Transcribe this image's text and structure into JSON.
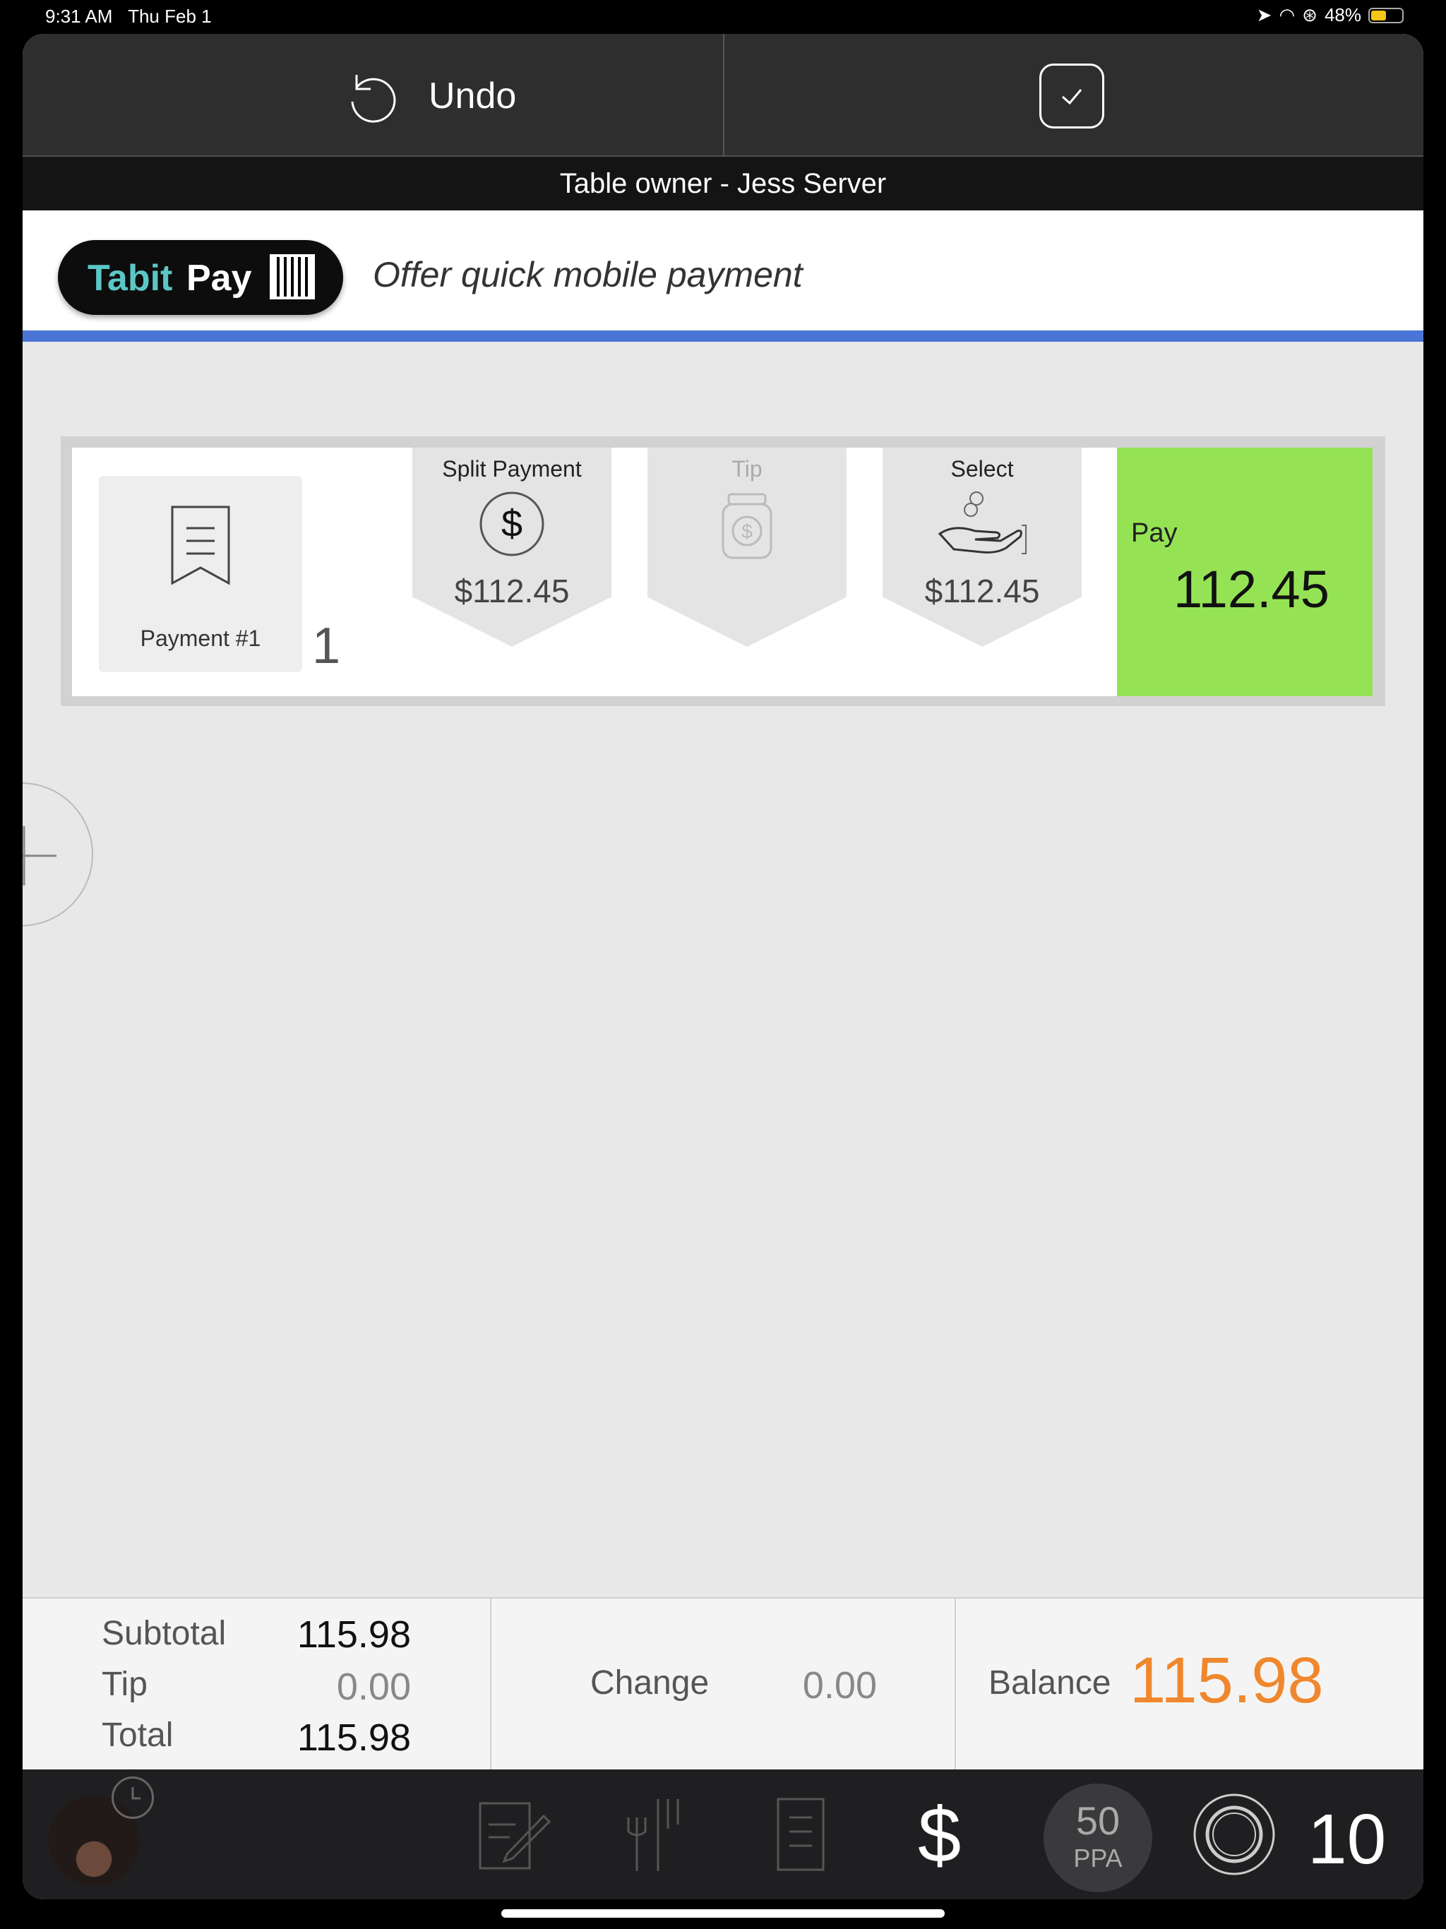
{
  "status": {
    "time": "9:31 AM",
    "date": "Thu Feb 1",
    "battery": "48%"
  },
  "topbar": {
    "undo_label": "Undo"
  },
  "owner": {
    "text": "Table owner - Jess Server"
  },
  "promo": {
    "brand_part1": "Tabit",
    "brand_part2": "Pay",
    "tagline": "Offer quick mobile payment"
  },
  "payment": {
    "card_label": "Payment #1",
    "count": "1",
    "split": {
      "title": "Split Payment",
      "amount": "$112.45"
    },
    "tip": {
      "title": "Tip"
    },
    "select": {
      "title": "Select",
      "amount": "$112.45"
    },
    "pay": {
      "label": "Pay",
      "amount": "112.45"
    }
  },
  "totals": {
    "subtotal_label": "Subtotal",
    "subtotal": "115.98",
    "tip_label": "Tip",
    "tip": "0.00",
    "total_label": "Total",
    "total": "115.98",
    "change_label": "Change",
    "change": "0.00",
    "balance_label": "Balance",
    "balance": "115.98"
  },
  "bottombar": {
    "ppa_number": "50",
    "ppa_unit": "PPA",
    "guests": "10"
  },
  "colors": {
    "pay_green": "#95e355",
    "balance_orange": "#f0872d",
    "brand_teal": "#5cc6c6",
    "promo_blue": "#4a74d6"
  }
}
